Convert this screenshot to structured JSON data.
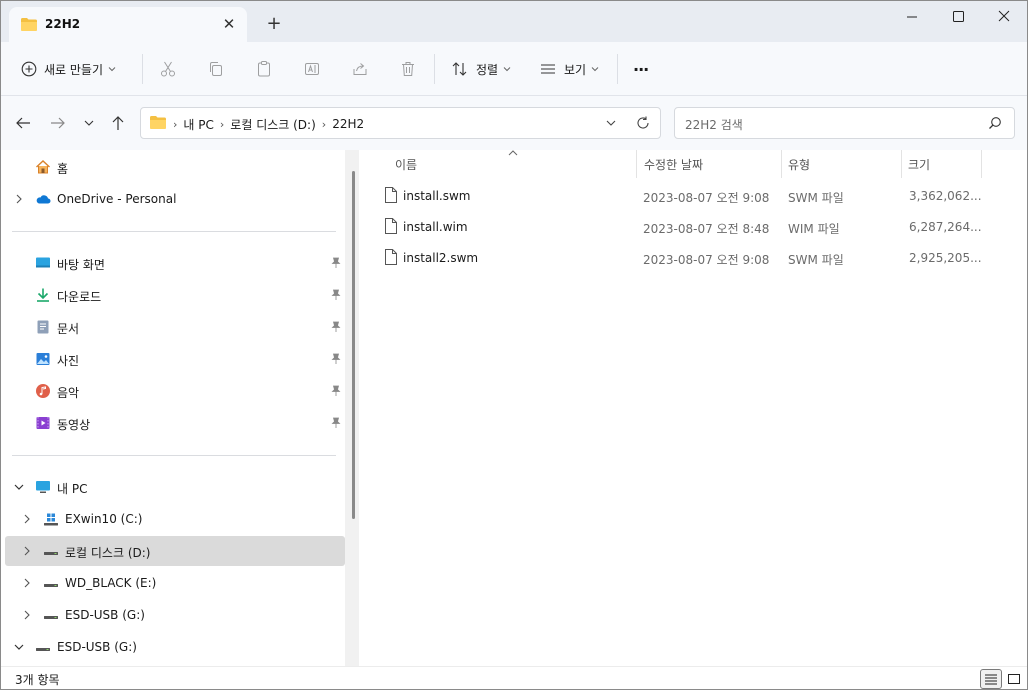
{
  "window": {
    "tab_title": "22H2",
    "tab_close": "✕",
    "new_tab": "+"
  },
  "toolbar": {
    "new_label": "새로 만들기",
    "sort_label": "정렬",
    "view_label": "보기",
    "more_label": "···"
  },
  "address": {
    "crumbs": [
      "내 PC",
      "로컬 디스크 (D:)",
      "22H2"
    ],
    "sep": "›"
  },
  "search": {
    "placeholder": "22H2 검색"
  },
  "sidebar": {
    "home": "홈",
    "onedrive": "OneDrive - Personal",
    "quick": [
      {
        "label": "바탕 화면",
        "icon": "desktop-icon",
        "color": "#2aa3e0"
      },
      {
        "label": "다운로드",
        "icon": "download-icon",
        "color": "#1ba86b"
      },
      {
        "label": "문서",
        "icon": "document-icon",
        "color": "#7d8ea8"
      },
      {
        "label": "사진",
        "icon": "pictures-icon",
        "color": "#2b7fd8"
      },
      {
        "label": "음악",
        "icon": "music-icon",
        "color": "#e0604a"
      },
      {
        "label": "동영상",
        "icon": "video-icon",
        "color": "#8a3fd1"
      }
    ],
    "this_pc": "내 PC",
    "drives": [
      {
        "label": "EXwin10 (C:)",
        "icon": "windows-drive-icon"
      },
      {
        "label": "로컬 디스크 (D:)",
        "icon": "drive-icon",
        "selected": true
      },
      {
        "label": "WD_BLACK (E:)",
        "icon": "drive-icon"
      },
      {
        "label": "ESD-USB (G:)",
        "icon": "drive-icon"
      }
    ],
    "esd_root": "ESD-USB (G:)"
  },
  "columns": {
    "name": "이름",
    "date": "수정한 날짜",
    "type": "유형",
    "size": "크기"
  },
  "files": [
    {
      "name": "install.swm",
      "date": "2023-08-07 오전 9:08",
      "type": "SWM 파일",
      "size": "3,362,062..."
    },
    {
      "name": "install.wim",
      "date": "2023-08-07 오전 8:48",
      "type": "WIM 파일",
      "size": "6,287,264..."
    },
    {
      "name": "install2.swm",
      "date": "2023-08-07 오전 9:08",
      "type": "SWM 파일",
      "size": "2,925,205..."
    }
  ],
  "status": {
    "item_count": "3개 항목"
  },
  "colors": {
    "folder": "#f4c042",
    "accent": "#0067c0",
    "selected_bg": "#dadada"
  }
}
